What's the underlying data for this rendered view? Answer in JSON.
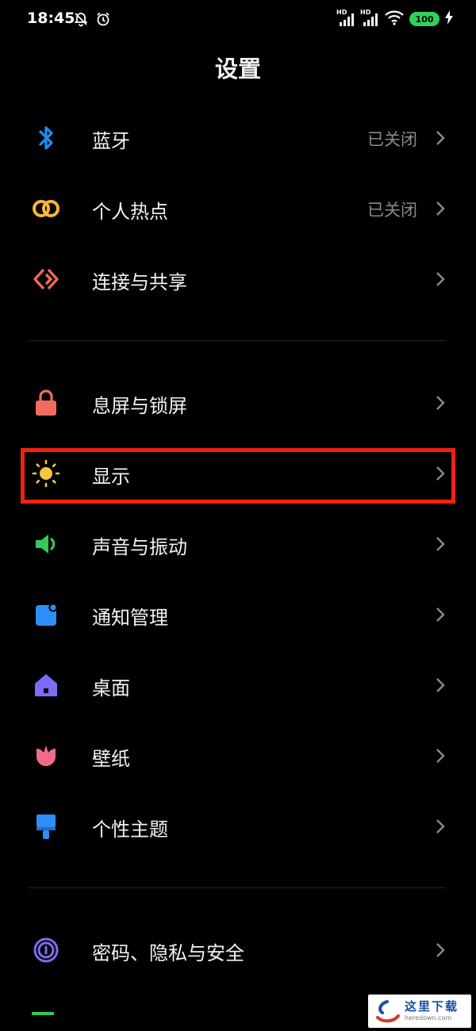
{
  "status_bar": {
    "time": "18:45",
    "hd_label": "HD",
    "battery": "100"
  },
  "header": {
    "title": "设置"
  },
  "items": [
    {
      "label": "蓝牙",
      "status": "已关闭",
      "icon": "bluetooth-icon",
      "color": "#1f8cf2"
    },
    {
      "label": "个人热点",
      "status": "已关闭",
      "icon": "hotspot-icon",
      "color": "#f4b63a"
    },
    {
      "label": "连接与共享",
      "status": "",
      "icon": "connection-share-icon",
      "color": "#ee6a57"
    },
    {
      "label": "息屏与锁屏",
      "status": "",
      "icon": "lock-icon",
      "color": "#f26b5d"
    },
    {
      "label": "显示",
      "status": "",
      "icon": "sun-icon",
      "color": "#f5c542"
    },
    {
      "label": "声音与振动",
      "status": "",
      "icon": "speaker-icon",
      "color": "#34c759"
    },
    {
      "label": "通知管理",
      "status": "",
      "icon": "notification-icon",
      "color": "#2f8ef5"
    },
    {
      "label": "桌面",
      "status": "",
      "icon": "home-icon",
      "color": "#7b6cf6"
    },
    {
      "label": "壁纸",
      "status": "",
      "icon": "tulip-icon",
      "color": "#f06b8a"
    },
    {
      "label": "个性主题",
      "status": "",
      "icon": "brush-icon",
      "color": "#2f8ef5"
    },
    {
      "label": "密码、隐私与安全",
      "status": "",
      "icon": "fingerprint-icon",
      "color": "#7c6cf0"
    }
  ],
  "highlight_color": "#f02210",
  "watermark": {
    "text": "这里下载",
    "url": "heredown.com"
  }
}
